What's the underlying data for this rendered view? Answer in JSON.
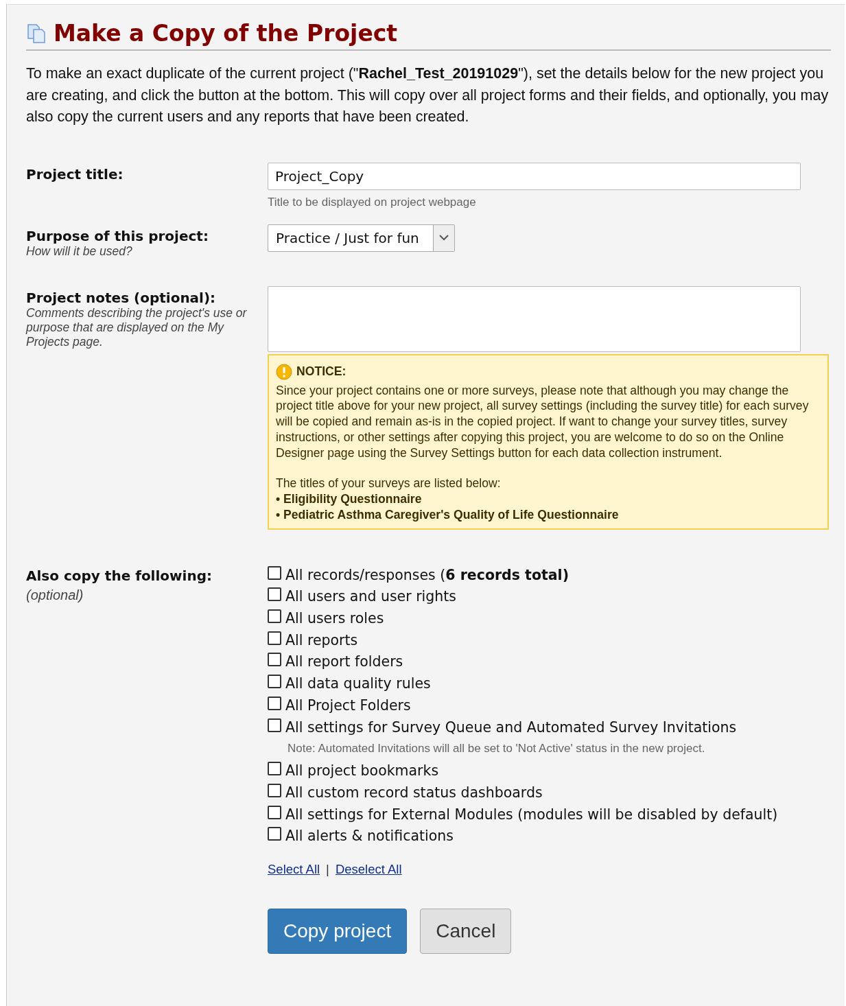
{
  "title": "Make a Copy of the Project",
  "intro": "To make an exact duplicate of the current project (\"**Rachel_Test_20191029**\"), set the details below for the new project you are creating, and click the button at the bottom. This will copy over all project forms and their fields, and optionally, you may also copy the current users and any reports that have been created.",
  "fields": [
    {
      "kind": "text",
      "label": "Project title:",
      "value": "Project_Copy",
      "hint": "Title to be displayed on project webpage"
    },
    {
      "kind": "select",
      "label": "Purpose of this project:",
      "sublabel": "How will it be used?",
      "value": "Practice / Just for fun"
    },
    {
      "kind": "textarea",
      "label": "Project notes (optional):",
      "sublabel": "Comments describing the project's use or purpose that are displayed on the My Projects page."
    }
  ],
  "notice": {
    "heading": "NOTICE:",
    "body": "Since your project contains one or more surveys, please note that although you may change the project title above for your new project, all survey settings (including the survey title) for each survey will be copied and remain as-is in the copied project. If want to change your survey titles, survey instructions, or other settings after copying this project, you are welcome to do so on the Online Designer page using the Survey Settings button for each data collection instrument.",
    "list_intro": "The titles of your surveys are listed below:",
    "surveys": [
      "• Eligibility Questionnaire",
      "• Pediatric Asthma Caregiver's Quality of Life Questionnaire"
    ]
  },
  "copy_options": {
    "label": "Also copy the following:",
    "sublabel": "(optional)",
    "items": [
      {
        "label": "All records/responses (**6 records total)**",
        "checked": false
      },
      {
        "label": "All users and user rights",
        "checked": false
      },
      {
        "label": "All users roles",
        "checked": false
      },
      {
        "label": "All reports",
        "checked": false
      },
      {
        "label": "All report folders",
        "checked": false
      },
      {
        "label": "All data quality rules",
        "checked": false
      },
      {
        "label": "All Project Folders",
        "checked": false
      },
      {
        "label": "All settings for Survey Queue and Automated Survey Invitations",
        "checked": false,
        "note": "Note: Automated Invitations will all be set to 'Not Active' status in the new project."
      },
      {
        "label": "All project bookmarks",
        "checked": false
      },
      {
        "label": "All custom record status dashboards",
        "checked": false
      },
      {
        "label": "All settings for External Modules (modules will be disabled by default)",
        "checked": false
      },
      {
        "label": "All alerts & notifications",
        "checked": false
      }
    ],
    "links": [
      "Select All",
      "Deselect All"
    ],
    "separator": "|"
  },
  "buttons": [
    {
      "label": "Copy project",
      "kind": "primary"
    },
    {
      "label": "Cancel",
      "kind": "secondary"
    }
  ]
}
